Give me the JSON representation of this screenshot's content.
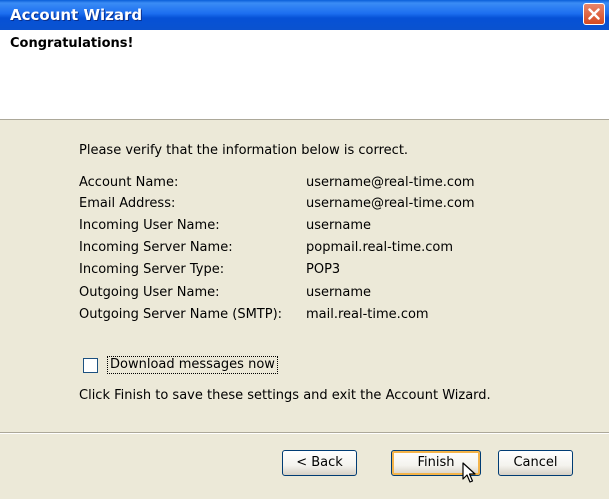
{
  "window": {
    "title": "Account Wizard"
  },
  "header": {
    "title": "Congratulations!"
  },
  "main": {
    "intro": "Please verify that the information below is correct.",
    "rows": [
      {
        "label": "Account Name:",
        "value": "username@real-time.com"
      },
      {
        "label": "Email Address:",
        "value": "username@real-time.com"
      },
      {
        "label": "Incoming User Name:",
        "value": "username"
      },
      {
        "label": "Incoming Server Name:",
        "value": "popmail.real-time.com"
      },
      {
        "label": "Incoming Server Type:",
        "value": "POP3"
      },
      {
        "label": "Outgoing User Name:",
        "value": "username"
      },
      {
        "label": "Outgoing Server Name (SMTP):",
        "value": "mail.real-time.com"
      }
    ],
    "download_label": "Download messages now",
    "download_checked": false,
    "finish_text": "Click Finish to save these settings and exit the Account Wizard."
  },
  "buttons": {
    "back": "< Back",
    "finish": "Finish",
    "cancel": "Cancel"
  },
  "icons": {
    "close": "close-icon",
    "cursor": "cursor-icon"
  },
  "colors": {
    "titlebar": "#0a52cf",
    "close_button": "#d54a21",
    "dialog_bg": "#ece9d8"
  }
}
